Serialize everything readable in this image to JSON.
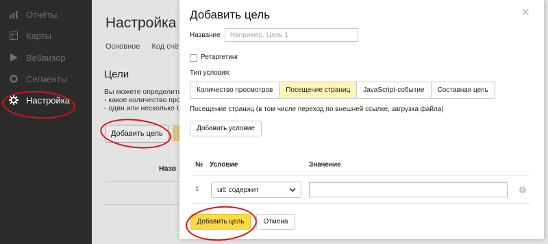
{
  "sidebar": {
    "items": [
      {
        "label": "Отчёты",
        "icon": "bar-chart-icon"
      },
      {
        "label": "Карты",
        "icon": "map-icon"
      },
      {
        "label": "Вебвизор",
        "icon": "play-icon"
      },
      {
        "label": "Сегменты",
        "icon": "pie-icon"
      },
      {
        "label": "Настройка",
        "icon": "gear-icon"
      }
    ]
  },
  "page": {
    "title": "Настройка",
    "tabs": [
      "Основное",
      "Код счётч"
    ],
    "goals_title": "Цели",
    "goals_text": [
      "Вы можете определить",
      "- какое количество прос",
      "- один или несколько U"
    ],
    "add_goal_button": "Добавить цель",
    "column_header": "Назв"
  },
  "modal": {
    "title": "Добавить цель",
    "close_symbol": "✕",
    "name_label": "Название",
    "name_value": "",
    "name_placeholder": "Например, Цель 1",
    "retargeting_label": "Ретаргетинг",
    "condition_type_label": "Тип условия:",
    "condition_types": [
      "Количество просмотров",
      "Посещение страниц",
      "JavaScript-событие",
      "Составная цель"
    ],
    "selected_condition_type": "Посещение страниц",
    "description": "Посещение страниц (в том числе переход по внешней ссылке, загрузка файла)",
    "add_condition_button": "Добавить условие",
    "table": {
      "headers": {
        "num": "№",
        "condition": "Условие",
        "value": "Значение"
      },
      "rows": [
        {
          "num": "1",
          "condition": "url: содержит",
          "value": ""
        }
      ]
    },
    "submit_button": "Добавить цель",
    "cancel_button": "Отмена"
  },
  "colors": {
    "sidebar_bg": "#2b2b2b",
    "accent_yellow": "#ffd94a",
    "selected_segment": "#fff3b8",
    "annotation_red": "#e01010"
  }
}
